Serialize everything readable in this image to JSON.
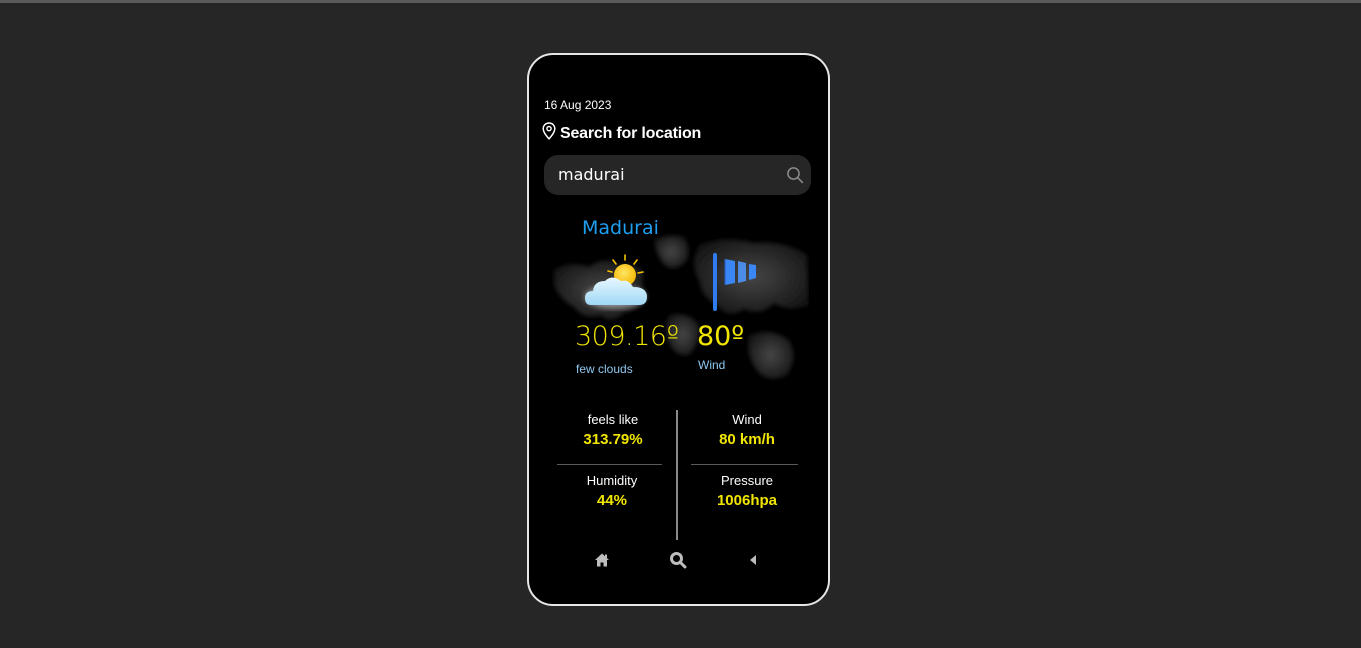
{
  "header": {
    "date": "16 Aug 2023",
    "location_title": "Search for location"
  },
  "search": {
    "value": "madurai",
    "placeholder": ""
  },
  "weather": {
    "city": "Madurai",
    "temperature": "309.16º",
    "condition": "few clouds",
    "wind_value": "80º",
    "wind_label": "Wind"
  },
  "stats": {
    "feels_like_label": "feels like",
    "feels_like_value": "313.79%",
    "wind_label": "Wind",
    "wind_value": "80 km/h",
    "humidity_label": "Humidity",
    "humidity_value": "44%",
    "pressure_label": "Pressure",
    "pressure_value": "1006hpa"
  },
  "icons": {
    "location": "map-pin-icon",
    "search": "search-icon",
    "weather": "sun-behind-cloud-icon",
    "wind": "windsock-icon",
    "nav_home": "home-icon",
    "nav_search": "search-icon",
    "nav_back": "back-arrow-icon"
  },
  "colors": {
    "accent_yellow": "#f2e600",
    "city_blue": "#1e9ff2",
    "caption_blue": "#8ec8ee",
    "search_bg": "#262626",
    "phone_bg": "#000000",
    "page_bg": "#262626"
  }
}
